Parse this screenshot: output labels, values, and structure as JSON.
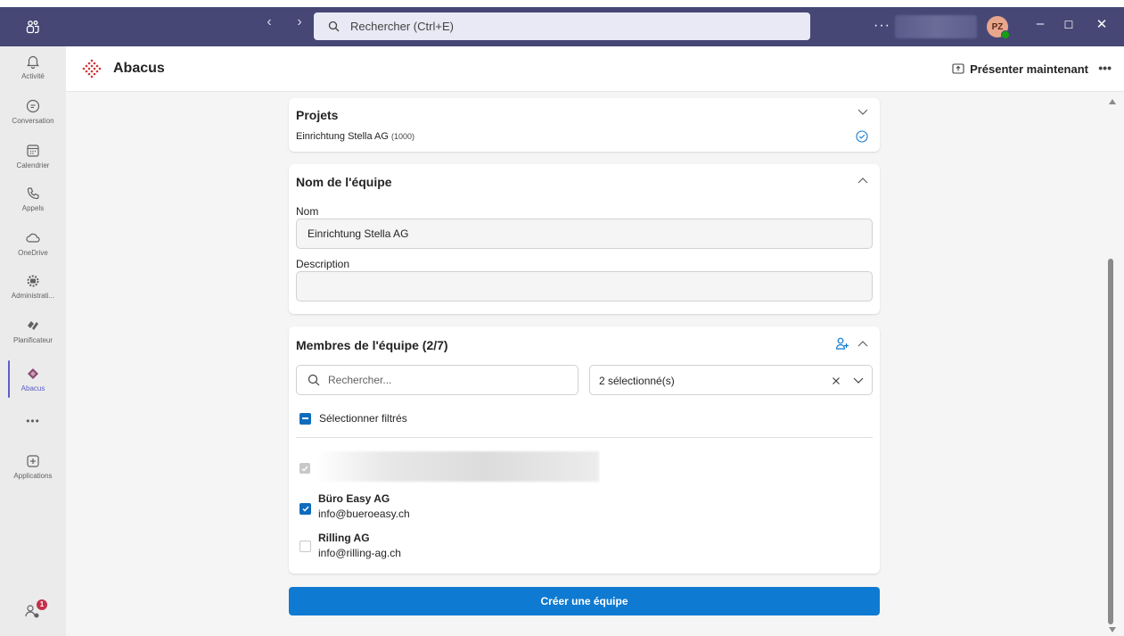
{
  "titlebar": {
    "search_placeholder": "Rechercher (Ctrl+E)",
    "more": "···",
    "avatar_initials": "PZ",
    "minimize": "–",
    "maximize": "☐",
    "close": "✕"
  },
  "rail": {
    "items": [
      {
        "label": "Activité",
        "icon": "bell-icon"
      },
      {
        "label": "Conversation",
        "icon": "chat-icon"
      },
      {
        "label": "Calendrier",
        "icon": "calendar-icon"
      },
      {
        "label": "Appels",
        "icon": "phone-icon"
      },
      {
        "label": "OneDrive",
        "icon": "cloud-icon"
      },
      {
        "label": "Administrati...",
        "icon": "admin-gear-icon"
      },
      {
        "label": "Planificateur",
        "icon": "planner-icon"
      },
      {
        "label": "Abacus",
        "icon": "abacus-icon"
      },
      {
        "label": "",
        "icon": "more-icon"
      },
      {
        "label": "Applications",
        "icon": "plus-square-icon"
      }
    ],
    "more_dots": "•••",
    "notification_badge": "1"
  },
  "header": {
    "app_name": "Abacus",
    "present_label": "Présenter maintenant",
    "more": "•••"
  },
  "projects": {
    "title": "Projets",
    "project_name": "Einrichtung Stella AG",
    "project_id": "(1000)"
  },
  "team_name": {
    "title": "Nom de l'équipe",
    "name_label": "Nom",
    "name_value": "Einrichtung Stella AG",
    "description_label": "Description",
    "description_value": ""
  },
  "members": {
    "title": "Membres de l'équipe (2/7)",
    "search_placeholder": "Rechercher...",
    "selection_summary": "2 sélectionné(s)",
    "select_filtered_label": "Sélectionner filtrés",
    "list": [
      {
        "name": "",
        "email": "",
        "checked": true,
        "disabled": true
      },
      {
        "name": "Büro Easy AG",
        "email": "info@bueroeasy.ch",
        "checked": true,
        "disabled": false
      },
      {
        "name": "Rilling AG",
        "email": "info@rilling-ag.ch",
        "checked": false,
        "disabled": false
      }
    ]
  },
  "actions": {
    "create_label": "Créer une équipe"
  },
  "colors": {
    "titlebar": "#464775",
    "accent": "#5b5fc7",
    "primary_button": "#0f7ad1",
    "checkbox": "#0f6cbd"
  }
}
